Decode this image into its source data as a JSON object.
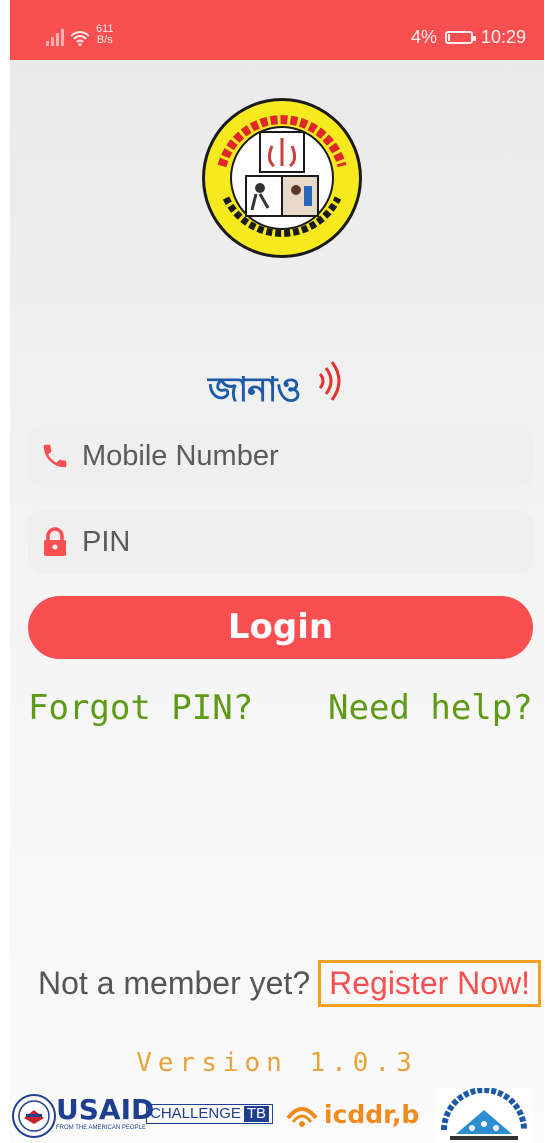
{
  "status_bar": {
    "net_speed_value": "611",
    "net_speed_unit": "B/s",
    "battery": "4%",
    "time": "10:29",
    "battery_level": 0.04
  },
  "emblem": {
    "icon": "tb-program-emblem",
    "lettering": "চিকিৎসায় যক্ষ্মা ভাল হয় — জাতীয় যক্ষ্মা নিয়ন্ত্রণ কর্মসূচি, স্বাস্থ্য অধিদপ্তর"
  },
  "app_logo": {
    "text": "জানাও",
    "icon": "signal-waves-icon"
  },
  "form": {
    "mobile_placeholder": "Mobile Number",
    "mobile_icon": "phone-icon",
    "pin_placeholder": "PIN",
    "pin_icon": "lock-icon",
    "login_label": "Login"
  },
  "links": {
    "forgot": "Forgot PIN?",
    "help": "Need help?"
  },
  "register": {
    "prompt": "Not a member yet?",
    "button": "Register Now!"
  },
  "version": "Version 1.0.3",
  "sponsors": {
    "usaid": "USAID",
    "usaid_tagline": "FROM THE AMERICAN PEOPLE",
    "challenge": "CHALLENGE",
    "challenge_tb": "TB",
    "icddrb": "icddr,b",
    "mohfw_lettering": "আপনার স্বাস্থ্য আমাদের অঙ্গীকার — স্বাস্থ্য ও পরিবার কল্যাণ মন্ত্রণালয়"
  },
  "colors": {
    "accent": "#f94f50",
    "link_green": "#5f9a16",
    "version_orange": "#e8a33d",
    "register_border": "#f2a11e",
    "brand_blue": "#1d5aa8"
  }
}
